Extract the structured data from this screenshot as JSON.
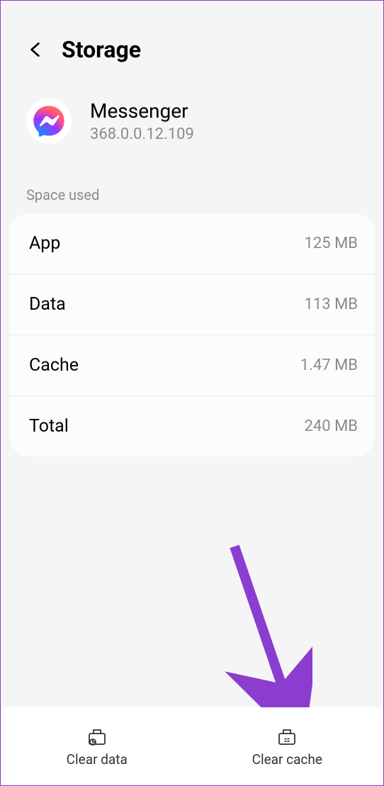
{
  "header": {
    "title": "Storage"
  },
  "app": {
    "name": "Messenger",
    "version": "368.0.0.12.109"
  },
  "section": {
    "label": "Space used"
  },
  "rows": [
    {
      "label": "App",
      "value": "125 MB"
    },
    {
      "label": "Data",
      "value": "113 MB"
    },
    {
      "label": "Cache",
      "value": "1.47 MB"
    },
    {
      "label": "Total",
      "value": "240 MB"
    }
  ],
  "actions": {
    "clearData": "Clear data",
    "clearCache": "Clear cache"
  }
}
